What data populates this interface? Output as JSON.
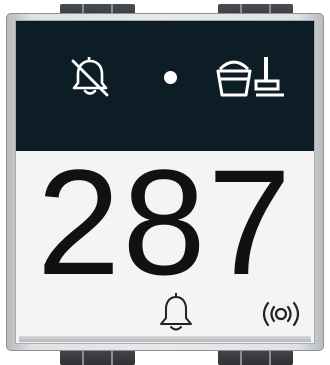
{
  "display": {
    "room_number": "287"
  },
  "status_bar": {
    "icons": {
      "left": "bell-off-icon",
      "center": "status-dot",
      "right": "cleaning-icon"
    },
    "colors": {
      "background": "#0d1d26",
      "icon": "#ffffff"
    }
  },
  "bottom_icons": {
    "left": "bell-icon",
    "right": "wireless-icon"
  },
  "colors": {
    "panel": "#f4f4f4",
    "text": "#111111",
    "frame": "#e0e2e4"
  }
}
